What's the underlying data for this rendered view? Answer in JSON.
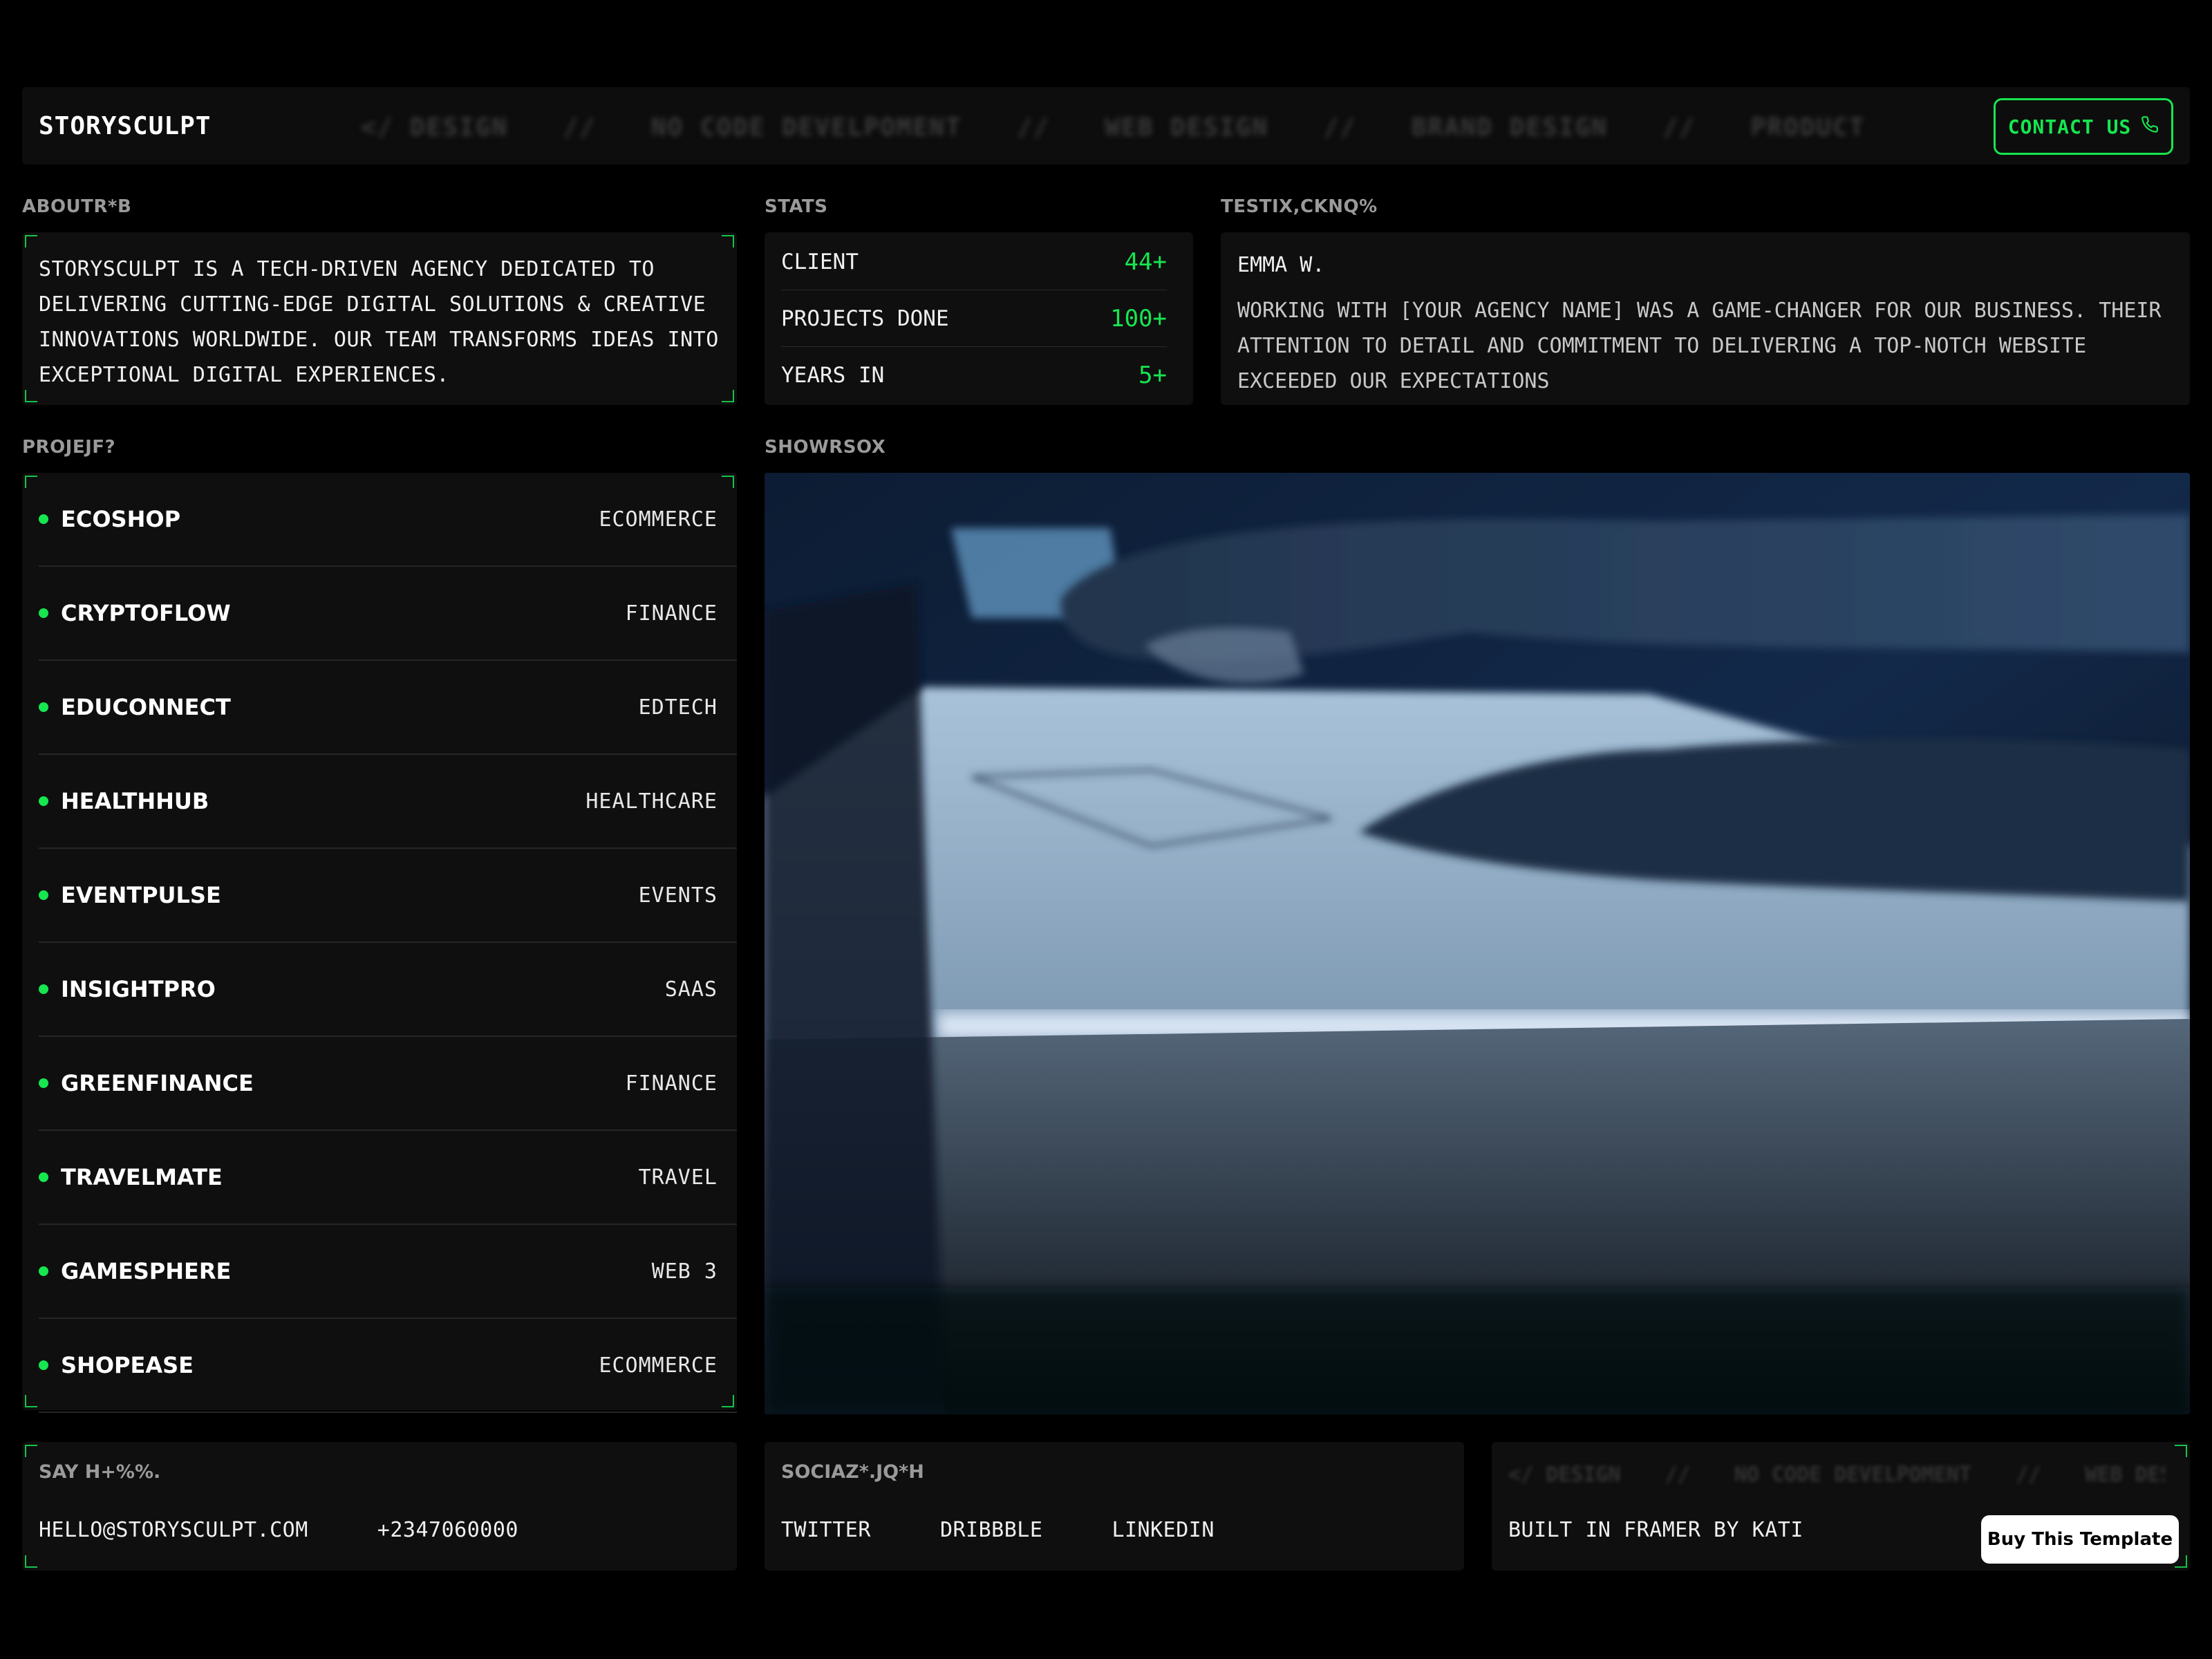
{
  "header": {
    "brand": "STORYSCULPT",
    "marquee": [
      "</ DESIGN",
      "//",
      "NO CODE DEVELPOMENT",
      "//",
      "WEB DESIGN",
      "//",
      "BRAND DESIGN",
      "//",
      "PRODUCT DESIGN",
      "//"
    ],
    "contact_label": "CONTACT US",
    "contact_icon": "phone-icon"
  },
  "about": {
    "label": "ABOUTR*B",
    "text": "STORYSCULPT IS A TECH-DRIVEN AGENCY DEDICATED TO DELIVERING CUTTING-EDGE DIGITAL SOLUTIONS & CREATIVE INNOVATIONS WORLDWIDE. OUR TEAM TRANSFORMS IDEAS INTO EXCEPTIONAL DIGITAL EXPERIENCES."
  },
  "stats": {
    "label": "STATS",
    "items": [
      {
        "label": "CLIENT",
        "value": "44+"
      },
      {
        "label": "PROJECTS DONE",
        "value": "100+"
      },
      {
        "label": "YEARS IN",
        "value": "5+"
      }
    ]
  },
  "testimonial": {
    "label": "TESTIX,CKNQ%",
    "name": "EMMA W.",
    "quote": "WORKING WITH [YOUR AGENCY NAME] WAS A GAME-CHANGER FOR OUR BUSINESS. THEIR ATTENTION TO DETAIL AND COMMITMENT TO DELIVERING A TOP-NOTCH WEBSITE EXCEEDED OUR EXPECTATIONS"
  },
  "projects": {
    "label": "PROJEJF?",
    "items": [
      {
        "name": "ECOSHOP",
        "category": "ECOMMERCE"
      },
      {
        "name": "CRYPTOFLOW",
        "category": "FINANCE"
      },
      {
        "name": "EDUCONNECT",
        "category": "EDTECH"
      },
      {
        "name": "HEALTHHUB",
        "category": "HEALTHCARE"
      },
      {
        "name": "EVENTPULSE",
        "category": "EVENTS"
      },
      {
        "name": "INSIGHTPRO",
        "category": "SAAS"
      },
      {
        "name": "GREENFINANCE",
        "category": "FINANCE"
      },
      {
        "name": "TRAVELMATE",
        "category": "TRAVEL"
      },
      {
        "name": "GAMESPHERE",
        "category": "WEB 3"
      },
      {
        "name": "SHOPEASE",
        "category": "ECOMMERCE"
      }
    ]
  },
  "showreel": {
    "label": "SHOWRSOX"
  },
  "say_hello": {
    "label": "SAY H+%%.",
    "email": "HELLO@STORYSCULPT.COM",
    "phone": "+2347060000"
  },
  "social": {
    "label": "SOCIAZ*.JQ*H",
    "links": [
      "TWITTER",
      "DRIBBBLE",
      "LINKEDIN"
    ]
  },
  "built": {
    "marquee": [
      "</ DESIGN",
      "//",
      "NO CODE DEVELPOMENT",
      "//",
      "WEB DESIGN"
    ],
    "text": "BUILT IN FRAMER BY KATI",
    "buy_label": "Buy This Template"
  },
  "colors": {
    "background": "#000000",
    "panel": "#0f0f0f",
    "accent": "#16e64f"
  }
}
